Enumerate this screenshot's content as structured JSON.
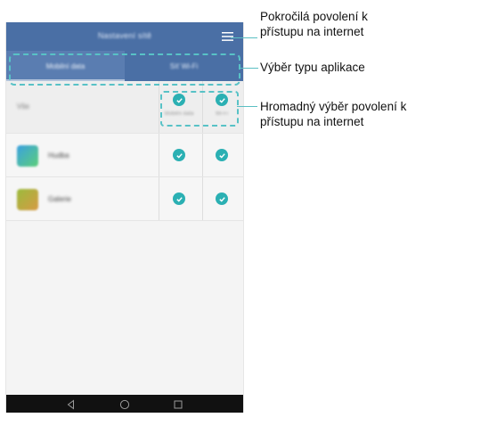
{
  "app_bar": {
    "title": "Nastavení sítě",
    "menu_icon": "menu-icon"
  },
  "tabs": [
    {
      "label": "Mobilní data"
    },
    {
      "label": "Síť Wi‑Fi"
    }
  ],
  "list": {
    "all_row": {
      "label": "Vše",
      "col1_caption": "Mobilní data",
      "col2_caption": "Wi-Fi"
    },
    "apps": [
      {
        "name": "Hudba",
        "icon": "app-icon"
      },
      {
        "name": "Galerie",
        "icon": "app-icon"
      }
    ]
  },
  "callouts": {
    "advanced": "Pokročilá povolení k\npřístupu na internet",
    "app_type": "Výběr typu aplikace",
    "bulk": "Hromadný výběr povolení k\npřístupu na internet"
  },
  "colors": {
    "app_bar": "#4a6fa5",
    "check": "#2bb0b3",
    "callout_line": "#58c2c6",
    "nav_bar": "#111111"
  }
}
